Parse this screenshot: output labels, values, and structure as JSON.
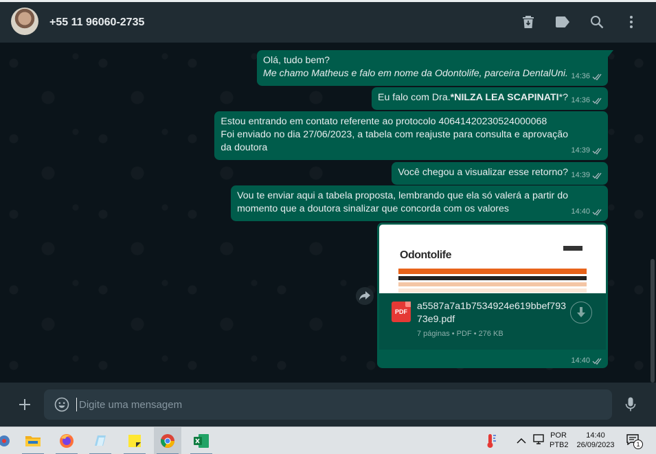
{
  "header": {
    "contact_name": "+55 11 96060-2735",
    "icons": [
      "delete-icon",
      "label-icon",
      "search-icon",
      "menu-icon"
    ]
  },
  "messages": [
    {
      "lines": [
        {
          "text": "Olá, tudo bem?",
          "style": "normal"
        },
        {
          "text": "Me chamo Matheus e falo em nome da Odontolife, parceira DentalUni.",
          "style": "italic"
        }
      ],
      "time": "14:36"
    },
    {
      "prefix": "Eu falo com Dra.",
      "bold": "*NILZA LEA SCAPINATI",
      "suffix": "*?",
      "time": "14:36"
    },
    {
      "lines": [
        {
          "text": "Estou entrando em contato referente ao protocolo 40641420230524000068"
        },
        {
          "text": "Foi enviado no dia 27/06/2023, a tabela com reajuste para consulta e aprovação"
        },
        {
          "text": "da doutora"
        }
      ],
      "time": "14:39"
    },
    {
      "lines": [
        {
          "text": "Você chegou a visualizar esse retorno?"
        }
      ],
      "time": "14:39"
    },
    {
      "lines": [
        {
          "text": "Vou te enviar aqui a tabela proposta, lembrando que ela só valerá a partir do"
        },
        {
          "text": "momento que a doutora sinalizar que concorda com os valores"
        }
      ],
      "time": "14:40"
    }
  ],
  "document": {
    "filename": "a5587a7a1b7534924e619bbef79373e9.pdf",
    "details": "7 páginas • PDF • 276 KB",
    "icon_label": "PDF",
    "time": "14:40",
    "preview_logo": "Odontolife"
  },
  "composer": {
    "placeholder": "Digite uma mensagem"
  },
  "taskbar": {
    "language": "POR",
    "layout": "PTB2",
    "time": "14:40",
    "date": "26/09/2023",
    "notification_count": "1"
  },
  "colors": {
    "outgoing_bubble": "#005c4b",
    "header": "#202c33",
    "chat_background": "#0b141a"
  }
}
